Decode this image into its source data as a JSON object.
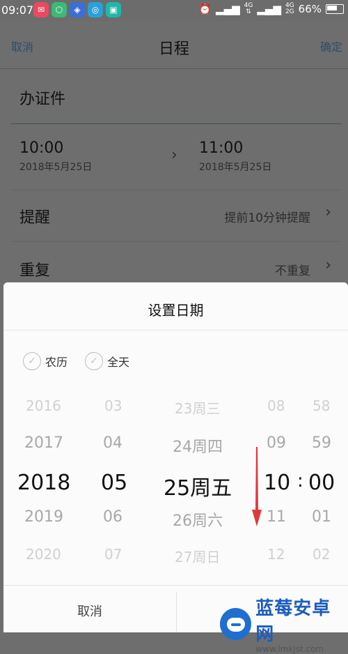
{
  "status_bar": {
    "time": "09:07",
    "network": "4G",
    "network2": "4G",
    "sub_network": "2G",
    "battery": "66%",
    "icons": [
      "message-app-icon",
      "security-app-icon",
      "shield-app-icon",
      "camera-app-icon",
      "scanner-app-icon",
      "alarm-icon",
      "signal-icon",
      "battery-icon"
    ]
  },
  "header": {
    "cancel": "取消",
    "title": "日程",
    "confirm": "确定"
  },
  "event": {
    "title": "办证件",
    "start_time": "10:00",
    "start_date": "2018年5月25日",
    "end_time": "11:00",
    "end_date": "2018年5月25日"
  },
  "settings": {
    "reminder_label": "提醒",
    "reminder_value": "提前10分钟提醒",
    "repeat_label": "重复",
    "repeat_value": "不重复"
  },
  "date_dialog": {
    "title": "设置日期",
    "lunar_label": "农历",
    "allday_label": "全天",
    "years": [
      "2016",
      "2017",
      "2018",
      "2019",
      "2020"
    ],
    "months": [
      "03",
      "04",
      "05",
      "06",
      "07"
    ],
    "days": [
      "23周三",
      "24周四",
      "25周五",
      "26周六",
      "27周日"
    ],
    "hours": [
      "08",
      "09",
      "10",
      "11",
      "12"
    ],
    "minutes": [
      "58",
      "59",
      "00",
      "01",
      "02"
    ],
    "separator": ":",
    "cancel": "取消"
  },
  "watermark": {
    "name": "蓝莓安卓网",
    "url": "www.lmkjst.com"
  },
  "colors": {
    "accent": "#2d4e6a",
    "sheet_bg": "#fbfbfb",
    "arrow": "#e03a3a",
    "watermark": "#1d5cbf"
  }
}
